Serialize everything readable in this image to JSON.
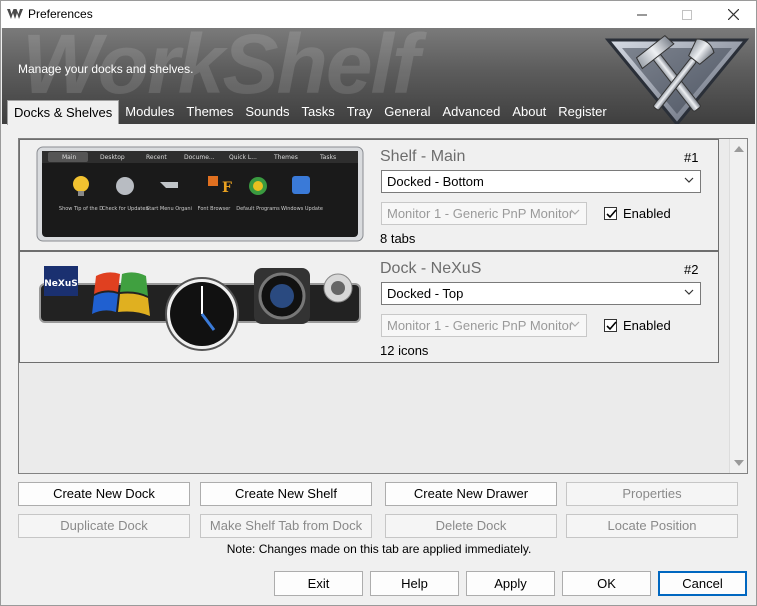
{
  "window": {
    "title": "Preferences"
  },
  "banner": {
    "watermark": "WorkShelf",
    "subtitle": "Manage your docks and shelves."
  },
  "tabs": [
    {
      "label": "Docks & Shelves",
      "active": true
    },
    {
      "label": "Modules"
    },
    {
      "label": "Themes"
    },
    {
      "label": "Sounds"
    },
    {
      "label": "Tasks"
    },
    {
      "label": "Tray"
    },
    {
      "label": "General"
    },
    {
      "label": "Advanced"
    },
    {
      "label": "About"
    },
    {
      "label": "Register"
    }
  ],
  "items": [
    {
      "title": "Shelf - Main",
      "number": "#1",
      "mode": "Docked - Bottom",
      "monitor": "Monitor 1 - Generic PnP Monitor",
      "enabled_label": "Enabled",
      "enabled": true,
      "count": "8 tabs",
      "preview_tabs": [
        "Main",
        "Desktop",
        "Recent",
        "Docume...",
        "Quick L...",
        "Themes",
        "Tasks"
      ],
      "preview_icons": [
        "Show Tip of the D",
        "Check for Updates",
        "Start Menu Organi",
        "Font Browser",
        "Default Programs",
        "Windows Update"
      ]
    },
    {
      "title": "Dock - NeXuS",
      "number": "#2",
      "mode": "Docked - Top",
      "monitor": "Monitor 1 - Generic PnP Monitor",
      "enabled_label": "Enabled",
      "enabled": true,
      "count": "12 icons",
      "preview_logo": "NeXuS"
    }
  ],
  "buttons": {
    "create_dock": "Create New Dock",
    "create_shelf": "Create New Shelf",
    "create_drawer": "Create New Drawer",
    "properties": "Properties",
    "duplicate_dock": "Duplicate Dock",
    "make_shelf_tab": "Make Shelf Tab from Dock",
    "delete_dock": "Delete Dock",
    "locate_position": "Locate Position"
  },
  "note": "Note: Changes made on this tab are applied immediately.",
  "footer": {
    "exit": "Exit",
    "help": "Help",
    "apply": "Apply",
    "ok": "OK",
    "cancel": "Cancel"
  },
  "colors": {
    "accent": "#0067c0",
    "banner_dark": "#3f3f3f"
  }
}
